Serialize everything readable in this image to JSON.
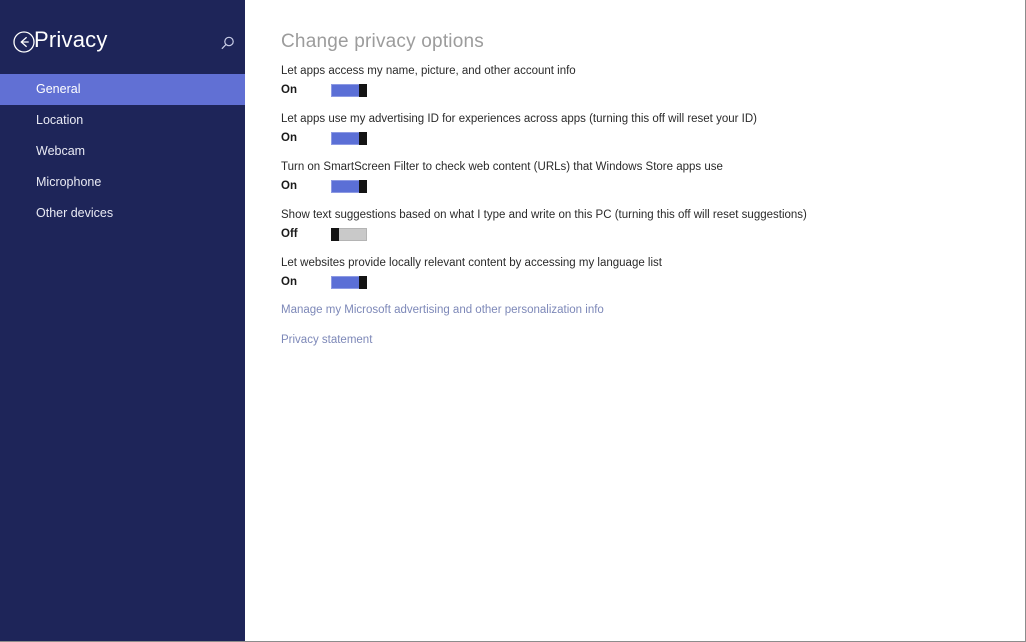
{
  "sidebar": {
    "title": "Privacy",
    "back_icon": "back-arrow-circle-icon",
    "search_icon": "search-icon",
    "items": [
      {
        "label": "General",
        "selected": true
      },
      {
        "label": "Location",
        "selected": false
      },
      {
        "label": "Webcam",
        "selected": false
      },
      {
        "label": "Microphone",
        "selected": false
      },
      {
        "label": "Other devices",
        "selected": false
      }
    ],
    "background_color": "#1e2559",
    "selected_color": "#6170d4"
  },
  "main": {
    "title": "Change privacy options",
    "settings": [
      {
        "label": "Let apps access my name, picture, and other account info",
        "state": "On",
        "on": true
      },
      {
        "label": "Let apps use my advertising ID for experiences across apps (turning this off will reset your ID)",
        "state": "On",
        "on": true
      },
      {
        "label": "Turn on SmartScreen Filter to check web content (URLs) that Windows Store apps use",
        "state": "On",
        "on": true
      },
      {
        "label": "Show text suggestions based on what I type and write on this PC (turning this off will reset suggestions)",
        "state": "Off",
        "on": false
      },
      {
        "label": "Let websites provide locally relevant content by accessing my language list",
        "state": "On",
        "on": true
      }
    ],
    "links": [
      {
        "label": "Manage my Microsoft advertising and other personalization info"
      },
      {
        "label": "Privacy statement"
      }
    ],
    "toggle_on_color": "#5b6fd6",
    "toggle_off_color": "#c9c9c9",
    "link_color": "#7d88b8",
    "title_color": "#9c9c9c"
  }
}
